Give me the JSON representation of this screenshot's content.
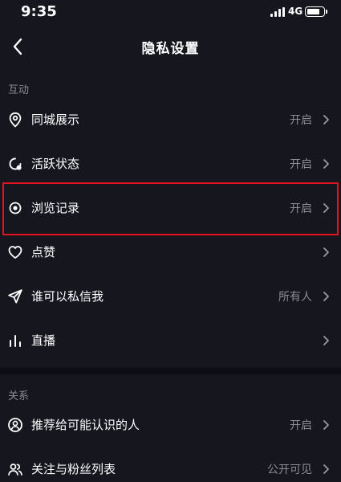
{
  "status_bar": {
    "time": "9:35",
    "network": "4G"
  },
  "header": {
    "title": "隐私设置"
  },
  "sections": [
    {
      "header": "互动",
      "items": [
        {
          "label": "同城展示",
          "value": "开启",
          "icon": "location-pin-icon"
        },
        {
          "label": "活跃状态",
          "value": "开启",
          "icon": "active-status-icon"
        },
        {
          "label": "浏览记录",
          "value": "开启",
          "icon": "eye-icon"
        },
        {
          "label": "点赞",
          "value": "",
          "icon": "heart-icon"
        },
        {
          "label": "谁可以私信我",
          "value": "所有人",
          "icon": "send-icon"
        },
        {
          "label": "直播",
          "value": "",
          "icon": "bar-chart-icon"
        }
      ]
    },
    {
      "header": "关系",
      "items": [
        {
          "label": "推荐给可能认识的人",
          "value": "开启",
          "icon": "user-circle-icon"
        },
        {
          "label": "关注与粉丝列表",
          "value": "公开可见",
          "icon": "users-icon"
        }
      ]
    }
  ],
  "colors": {
    "background": "#16161f",
    "highlight": "#e3141f",
    "secondary_text": "#8c8c94"
  }
}
